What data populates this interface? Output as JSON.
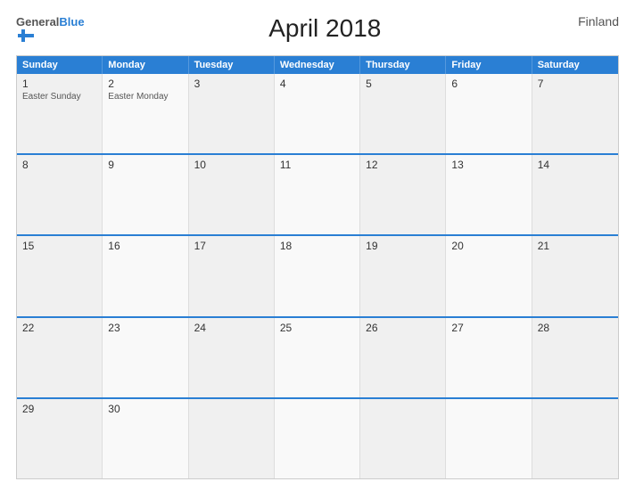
{
  "header": {
    "logo_general": "General",
    "logo_blue": "Blue",
    "title": "April 2018",
    "country": "Finland"
  },
  "calendar": {
    "days_of_week": [
      "Sunday",
      "Monday",
      "Tuesday",
      "Wednesday",
      "Thursday",
      "Friday",
      "Saturday"
    ],
    "weeks": [
      [
        {
          "day": "1",
          "event": "Easter Sunday"
        },
        {
          "day": "2",
          "event": "Easter Monday"
        },
        {
          "day": "3",
          "event": ""
        },
        {
          "day": "4",
          "event": ""
        },
        {
          "day": "5",
          "event": ""
        },
        {
          "day": "6",
          "event": ""
        },
        {
          "day": "7",
          "event": ""
        }
      ],
      [
        {
          "day": "8",
          "event": ""
        },
        {
          "day": "9",
          "event": ""
        },
        {
          "day": "10",
          "event": ""
        },
        {
          "day": "11",
          "event": ""
        },
        {
          "day": "12",
          "event": ""
        },
        {
          "day": "13",
          "event": ""
        },
        {
          "day": "14",
          "event": ""
        }
      ],
      [
        {
          "day": "15",
          "event": ""
        },
        {
          "day": "16",
          "event": ""
        },
        {
          "day": "17",
          "event": ""
        },
        {
          "day": "18",
          "event": ""
        },
        {
          "day": "19",
          "event": ""
        },
        {
          "day": "20",
          "event": ""
        },
        {
          "day": "21",
          "event": ""
        }
      ],
      [
        {
          "day": "22",
          "event": ""
        },
        {
          "day": "23",
          "event": ""
        },
        {
          "day": "24",
          "event": ""
        },
        {
          "day": "25",
          "event": ""
        },
        {
          "day": "26",
          "event": ""
        },
        {
          "day": "27",
          "event": ""
        },
        {
          "day": "28",
          "event": ""
        }
      ],
      [
        {
          "day": "29",
          "event": ""
        },
        {
          "day": "30",
          "event": ""
        },
        {
          "day": "",
          "event": ""
        },
        {
          "day": "",
          "event": ""
        },
        {
          "day": "",
          "event": ""
        },
        {
          "day": "",
          "event": ""
        },
        {
          "day": "",
          "event": ""
        }
      ]
    ]
  }
}
